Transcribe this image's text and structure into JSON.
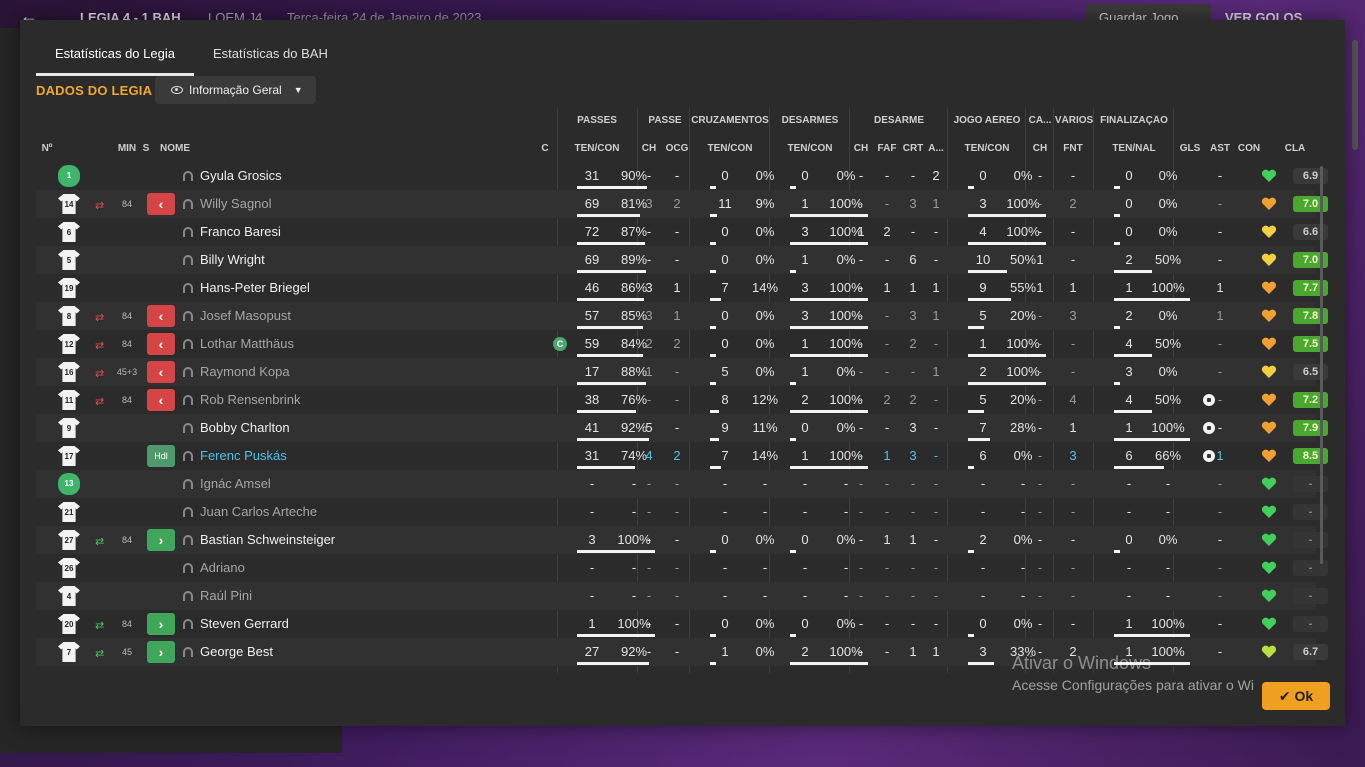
{
  "bg": {
    "score": "LEGIA   4 - 1   BAH",
    "competition": "LOEM J4",
    "date": "Terça-feira 24 de Janeiro de 2023",
    "save_label": "Guardar Jogo",
    "goals_label": "VER GOLOS"
  },
  "tabs": [
    {
      "label": "Estatísticas do Legia",
      "active": true
    },
    {
      "label": "Estatísticas do BAH",
      "active": false
    }
  ],
  "section_title": "DADOS DO LEGIA",
  "view_dropdown": "Informação Geral",
  "groups": {
    "passes": "PASSES",
    "passe": "PASSE",
    "cruz": "CRUZAMENTOS",
    "desarmes": "DESARMES",
    "desarme": "DESARME",
    "aereo": "JOGO AÉREO",
    "ca": "CA...",
    "varios": "VÁRIOS",
    "final": "FINALIZAÇÃO"
  },
  "headers": {
    "num": "Nº",
    "min": "MIN",
    "s": "S",
    "nome": "NOME",
    "c": "C",
    "passes": "TEN/CON",
    "ch": "CH",
    "ocg": "OCG",
    "cruz": "TEN/CON",
    "des": "TEN/CON",
    "dch": "CH",
    "faf": "FAF",
    "crt": "CRT",
    "a": "A...",
    "aer": "TEN/CON",
    "cach": "CH",
    "fnt": "FNT",
    "fin": "TEN/NAL",
    "gls": "GLS",
    "ast": "AST",
    "con": "CON",
    "cla": "CLA"
  },
  "players": [
    {
      "num": "1",
      "gk": true,
      "swap": "",
      "min": "",
      "s": "",
      "name": "Gyula Grosics",
      "style": "",
      "c": "",
      "pt": "31",
      "pp": "90%",
      "pb": 0.9,
      "ch": "-",
      "ocg": "-",
      "ct": "0",
      "cp": "0%",
      "cb": 0,
      "dt": "0",
      "dp": "0%",
      "db": 0,
      "dch": "-",
      "faf": "-",
      "crt": "-",
      "a": "2",
      "at": "0",
      "ap": "0%",
      "ab": 0,
      "cach": "-",
      "fnt": "-",
      "ft": "0",
      "fp": "0%",
      "fb": 0,
      "gls": "",
      "ast": "-",
      "mood": "green",
      "cla": "6.9",
      "cls": "mid"
    },
    {
      "num": "14",
      "gk": false,
      "swap": "out",
      "min": "84",
      "s": "out",
      "name": "Willy Sagnol",
      "style": "sub",
      "c": "",
      "pt": "69",
      "pp": "81%",
      "pb": 0.81,
      "ch": "3",
      "ocg": "2",
      "ct": "11",
      "cp": "9%",
      "cb": 0.09,
      "dt": "1",
      "dp": "100%",
      "db": 1,
      "dch": "-",
      "faf": "-",
      "crt": "3",
      "a": "1",
      "at": "3",
      "ap": "100%",
      "ab": 1,
      "cach": "-",
      "fnt": "2",
      "ft": "0",
      "fp": "0%",
      "fb": 0,
      "gls": "",
      "ast": "-",
      "mood": "orange",
      "cla": "7.0",
      "cls": "hi"
    },
    {
      "num": "6",
      "gk": false,
      "swap": "",
      "min": "",
      "s": "",
      "name": "Franco Baresi",
      "style": "",
      "c": "",
      "pt": "72",
      "pp": "87%",
      "pb": 0.87,
      "ch": "-",
      "ocg": "-",
      "ct": "0",
      "cp": "0%",
      "cb": 0,
      "dt": "3",
      "dp": "100%",
      "db": 1,
      "dch": "1",
      "faf": "2",
      "crt": "-",
      "a": "-",
      "at": "4",
      "ap": "100%",
      "ab": 1,
      "cach": "-",
      "fnt": "-",
      "ft": "0",
      "fp": "0%",
      "fb": 0,
      "gls": "",
      "ast": "-",
      "mood": "yellow",
      "cla": "6.6",
      "cls": "mid"
    },
    {
      "num": "5",
      "gk": false,
      "swap": "",
      "min": "",
      "s": "",
      "name": "Billy Wright",
      "style": "",
      "c": "",
      "pt": "69",
      "pp": "89%",
      "pb": 0.89,
      "ch": "-",
      "ocg": "-",
      "ct": "0",
      "cp": "0%",
      "cb": 0,
      "dt": "1",
      "dp": "0%",
      "db": 0,
      "dch": "-",
      "faf": "-",
      "crt": "6",
      "a": "-",
      "at": "10",
      "ap": "50%",
      "ab": 0.5,
      "cach": "1",
      "fnt": "-",
      "ft": "2",
      "fp": "50%",
      "fb": 0.5,
      "gls": "",
      "ast": "-",
      "mood": "yellow",
      "cla": "7.0",
      "cls": "hi"
    },
    {
      "num": "19",
      "gk": false,
      "swap": "",
      "min": "",
      "s": "",
      "name": "Hans-Peter Briegel",
      "style": "",
      "c": "",
      "pt": "46",
      "pp": "86%",
      "pb": 0.86,
      "ch": "3",
      "ocg": "1",
      "ct": "7",
      "cp": "14%",
      "cb": 0.14,
      "dt": "3",
      "dp": "100%",
      "db": 1,
      "dch": "-",
      "faf": "1",
      "crt": "1",
      "a": "1",
      "at": "9",
      "ap": "55%",
      "ab": 0.55,
      "cach": "1",
      "fnt": "1",
      "ft": "1",
      "fp": "100%",
      "fb": 1,
      "gls": "",
      "ast": "1",
      "mood": "orange",
      "cla": "7.7",
      "cls": "hi"
    },
    {
      "num": "8",
      "gk": false,
      "swap": "out",
      "min": "84",
      "s": "out",
      "name": "Josef Masopust",
      "style": "sub",
      "c": "",
      "pt": "57",
      "pp": "85%",
      "pb": 0.85,
      "ch": "3",
      "ocg": "1",
      "ct": "0",
      "cp": "0%",
      "cb": 0,
      "dt": "3",
      "dp": "100%",
      "db": 1,
      "dch": "-",
      "faf": "-",
      "crt": "3",
      "a": "1",
      "at": "5",
      "ap": "20%",
      "ab": 0.2,
      "cach": "-",
      "fnt": "3",
      "ft": "2",
      "fp": "0%",
      "fb": 0,
      "gls": "",
      "ast": "1",
      "mood": "orange",
      "cla": "7.8",
      "cls": "hi"
    },
    {
      "num": "12",
      "gk": false,
      "swap": "out",
      "min": "84",
      "s": "out",
      "name": "Lothar Matthäus",
      "style": "sub",
      "c": "C",
      "pt": "59",
      "pp": "84%",
      "pb": 0.84,
      "ch": "2",
      "ocg": "2",
      "ct": "0",
      "cp": "0%",
      "cb": 0,
      "dt": "1",
      "dp": "100%",
      "db": 1,
      "dch": "-",
      "faf": "-",
      "crt": "2",
      "a": "-",
      "at": "1",
      "ap": "100%",
      "ab": 1,
      "cach": "-",
      "fnt": "-",
      "ft": "4",
      "fp": "50%",
      "fb": 0.5,
      "gls": "",
      "ast": "-",
      "mood": "orange",
      "cla": "7.5",
      "cls": "hi"
    },
    {
      "num": "16",
      "gk": false,
      "swap": "out",
      "min": "45+3",
      "s": "out",
      "name": "Raymond Kopa",
      "style": "sub",
      "c": "",
      "pt": "17",
      "pp": "88%",
      "pb": 0.88,
      "ch": "1",
      "ocg": "-",
      "ct": "5",
      "cp": "0%",
      "cb": 0,
      "dt": "1",
      "dp": "0%",
      "db": 0,
      "dch": "-",
      "faf": "-",
      "crt": "-",
      "a": "1",
      "at": "2",
      "ap": "100%",
      "ab": 1,
      "cach": "-",
      "fnt": "-",
      "ft": "3",
      "fp": "0%",
      "fb": 0,
      "gls": "",
      "ast": "-",
      "mood": "yellow",
      "cla": "6.5",
      "cls": "mid"
    },
    {
      "num": "11",
      "gk": false,
      "swap": "out",
      "min": "84",
      "s": "out",
      "name": "Rob Rensenbrink",
      "style": "sub",
      "c": "",
      "pt": "38",
      "pp": "76%",
      "pb": 0.76,
      "ch": "-",
      "ocg": "-",
      "ct": "8",
      "cp": "12%",
      "cb": 0.12,
      "dt": "2",
      "dp": "100%",
      "db": 1,
      "dch": "-",
      "faf": "2",
      "crt": "2",
      "a": "-",
      "at": "5",
      "ap": "20%",
      "ab": 0.2,
      "cach": "-",
      "fnt": "4",
      "ft": "4",
      "fp": "50%",
      "fb": 0.5,
      "gls": "ball",
      "ast": "-",
      "mood": "orange",
      "cla": "7.2",
      "cls": "hi"
    },
    {
      "num": "9",
      "gk": false,
      "swap": "",
      "min": "",
      "s": "",
      "name": "Bobby Charlton",
      "style": "",
      "c": "",
      "pt": "41",
      "pp": "92%",
      "pb": 0.92,
      "ch": "5",
      "ocg": "-",
      "ct": "9",
      "cp": "11%",
      "cb": 0.11,
      "dt": "0",
      "dp": "0%",
      "db": 0,
      "dch": "-",
      "faf": "-",
      "crt": "3",
      "a": "-",
      "at": "7",
      "ap": "28%",
      "ab": 0.28,
      "cach": "-",
      "fnt": "1",
      "ft": "1",
      "fp": "100%",
      "fb": 1,
      "gls": "ball",
      "ast": "-",
      "mood": "orange",
      "cla": "7.9",
      "cls": "hi"
    },
    {
      "num": "17",
      "gk": false,
      "swap": "",
      "min": "",
      "s": "sub",
      "name": "Ferenc Puskás",
      "style": "cyan",
      "c": "",
      "pt": "31",
      "pp": "74%",
      "pb": 0.74,
      "ch": "4",
      "ocg": "2",
      "ct": "7",
      "cp": "14%",
      "cb": 0.14,
      "dt": "1",
      "dp": "100%",
      "db": 1,
      "dch": "-",
      "faf": "1",
      "crt": "3",
      "a": "-",
      "at": "6",
      "ap": "0%",
      "ab": 0,
      "cach": "-",
      "fnt": "3",
      "ft": "6",
      "fp": "66%",
      "fb": 0.66,
      "gls": "ball",
      "ast": "1",
      "mood": "orange",
      "cla": "8.5",
      "cls": "hi"
    },
    {
      "num": "13",
      "gk": true,
      "swap": "",
      "min": "",
      "s": "",
      "name": "Ignác Amsel",
      "style": "sub",
      "c": "",
      "pt": "-",
      "pp": "-",
      "pb": 0,
      "ch": "-",
      "ocg": "-",
      "ct": "-",
      "cp": "-",
      "cb": 0,
      "dt": "-",
      "dp": "-",
      "db": 0,
      "dch": "-",
      "faf": "-",
      "crt": "-",
      "a": "-",
      "at": "-",
      "ap": "-",
      "ab": 0,
      "cach": "-",
      "fnt": "-",
      "ft": "-",
      "fp": "-",
      "fb": 0,
      "gls": "",
      "ast": "-",
      "mood": "green",
      "cla": "-",
      "cls": "none"
    },
    {
      "num": "21",
      "gk": false,
      "swap": "",
      "min": "",
      "s": "",
      "name": "Juan Carlos Arteche",
      "style": "sub",
      "c": "",
      "pt": "-",
      "pp": "-",
      "pb": 0,
      "ch": "-",
      "ocg": "-",
      "ct": "-",
      "cp": "-",
      "cb": 0,
      "dt": "-",
      "dp": "-",
      "db": 0,
      "dch": "-",
      "faf": "-",
      "crt": "-",
      "a": "-",
      "at": "-",
      "ap": "-",
      "ab": 0,
      "cach": "-",
      "fnt": "-",
      "ft": "-",
      "fp": "-",
      "fb": 0,
      "gls": "",
      "ast": "-",
      "mood": "green",
      "cla": "-",
      "cls": "none"
    },
    {
      "num": "27",
      "gk": false,
      "swap": "in",
      "min": "84",
      "s": "in",
      "name": "Bastian Schweinsteiger",
      "style": "",
      "c": "",
      "pt": "3",
      "pp": "100%",
      "pb": 1,
      "ch": "-",
      "ocg": "-",
      "ct": "0",
      "cp": "0%",
      "cb": 0,
      "dt": "0",
      "dp": "0%",
      "db": 0,
      "dch": "-",
      "faf": "1",
      "crt": "1",
      "a": "-",
      "at": "2",
      "ap": "0%",
      "ab": 0,
      "cach": "-",
      "fnt": "-",
      "ft": "0",
      "fp": "0%",
      "fb": 0,
      "gls": "",
      "ast": "-",
      "mood": "green",
      "cla": "-",
      "cls": "none"
    },
    {
      "num": "26",
      "gk": false,
      "swap": "",
      "min": "",
      "s": "",
      "name": "Adriano",
      "style": "sub",
      "c": "",
      "pt": "-",
      "pp": "-",
      "pb": 0,
      "ch": "-",
      "ocg": "-",
      "ct": "-",
      "cp": "-",
      "cb": 0,
      "dt": "-",
      "dp": "-",
      "db": 0,
      "dch": "-",
      "faf": "-",
      "crt": "-",
      "a": "-",
      "at": "-",
      "ap": "-",
      "ab": 0,
      "cach": "-",
      "fnt": "-",
      "ft": "-",
      "fp": "-",
      "fb": 0,
      "gls": "",
      "ast": "-",
      "mood": "green",
      "cla": "-",
      "cls": "none"
    },
    {
      "num": "4",
      "gk": false,
      "swap": "",
      "min": "",
      "s": "",
      "name": "Raúl Pini",
      "style": "sub",
      "c": "",
      "pt": "-",
      "pp": "-",
      "pb": 0,
      "ch": "-",
      "ocg": "-",
      "ct": "-",
      "cp": "-",
      "cb": 0,
      "dt": "-",
      "dp": "-",
      "db": 0,
      "dch": "-",
      "faf": "-",
      "crt": "-",
      "a": "-",
      "at": "-",
      "ap": "-",
      "ab": 0,
      "cach": "-",
      "fnt": "-",
      "ft": "-",
      "fp": "-",
      "fb": 0,
      "gls": "",
      "ast": "-",
      "mood": "green",
      "cla": "-",
      "cls": "none"
    },
    {
      "num": "20",
      "gk": false,
      "swap": "in",
      "min": "84",
      "s": "in",
      "name": "Steven Gerrard",
      "style": "",
      "c": "",
      "pt": "1",
      "pp": "100%",
      "pb": 1,
      "ch": "-",
      "ocg": "-",
      "ct": "0",
      "cp": "0%",
      "cb": 0,
      "dt": "0",
      "dp": "0%",
      "db": 0,
      "dch": "-",
      "faf": "-",
      "crt": "-",
      "a": "-",
      "at": "0",
      "ap": "0%",
      "ab": 0,
      "cach": "-",
      "fnt": "-",
      "ft": "1",
      "fp": "100%",
      "fb": 1,
      "gls": "",
      "ast": "-",
      "mood": "green",
      "cla": "-",
      "cls": "none"
    },
    {
      "num": "7",
      "gk": false,
      "swap": "in",
      "min": "45",
      "s": "in",
      "name": "George Best",
      "style": "",
      "c": "",
      "pt": "27",
      "pp": "92%",
      "pb": 0.92,
      "ch": "-",
      "ocg": "-",
      "ct": "1",
      "cp": "0%",
      "cb": 0,
      "dt": "2",
      "dp": "100%",
      "db": 1,
      "dch": "-",
      "faf": "-",
      "crt": "1",
      "a": "1",
      "at": "3",
      "ap": "33%",
      "ab": 0.33,
      "cach": "-",
      "fnt": "2",
      "ft": "1",
      "fp": "100%",
      "fb": 1,
      "gls": "",
      "ast": "-",
      "mood": "lime",
      "cla": "6.7",
      "cls": "mid"
    }
  ],
  "sub_marker_label": "Hdl",
  "colors": {
    "accent": "#f0a830",
    "out": "#d64545",
    "in": "#3fa65a",
    "cyan": "#4ec3e8"
  },
  "watermark": {
    "line1": "Ativar o Windows",
    "line2": "Acesse Configurações para ativar o Wi"
  },
  "ok_label": "Ok"
}
